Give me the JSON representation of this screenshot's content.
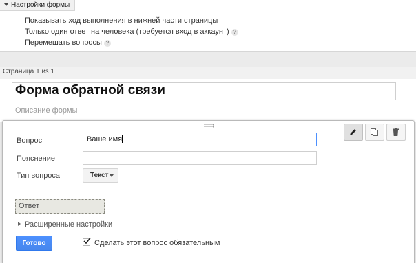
{
  "settings": {
    "tab_label": "Настройки формы",
    "options": [
      {
        "label": "Показывать ход выполнения в нижней части страницы",
        "checked": false,
        "help": false
      },
      {
        "label": "Только один ответ на человека (требуется вход в аккаунт)",
        "checked": false,
        "help": true
      },
      {
        "label": "Перемешать вопросы",
        "checked": false,
        "help": true
      }
    ],
    "help_glyph": "?"
  },
  "page": {
    "label": "Страница 1 из 1",
    "form_title": "Форма обратной связи",
    "form_description_placeholder": "Описание формы"
  },
  "editor": {
    "question_label": "Вопрос",
    "question_value": "Ваше имя",
    "hint_label": "Пояснение",
    "hint_value": "",
    "type_label": "Тип вопроса",
    "type_value": "Текст",
    "answer_placeholder": "Ответ",
    "advanced_label": "Расширенные настройки",
    "done_label": "Готово",
    "required_label": "Сделать этот вопрос обязательным",
    "required_checked": true,
    "tools": [
      "pencil-icon",
      "duplicate-icon",
      "trash-icon"
    ]
  },
  "colors": {
    "accent": "#4d90fe",
    "background": "#ebebeb"
  }
}
